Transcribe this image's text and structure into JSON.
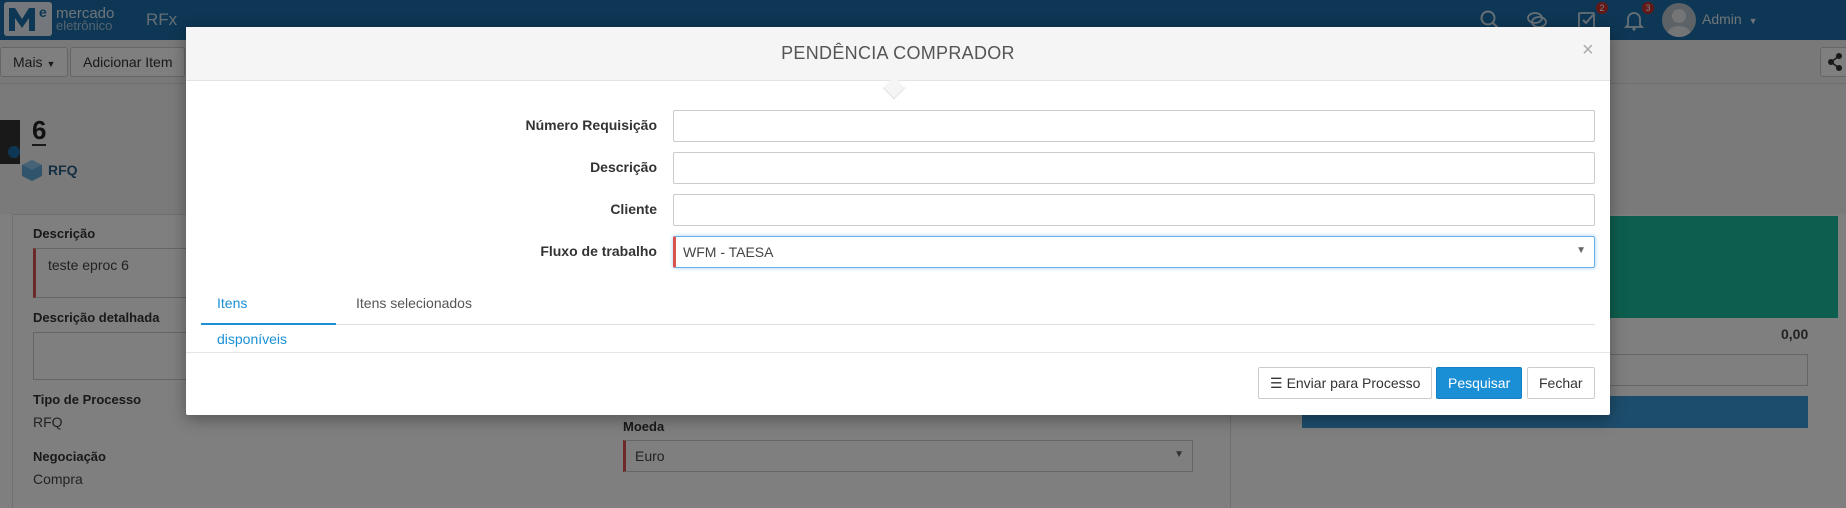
{
  "app": {
    "logo_line1": "mercado",
    "logo_line2": "eletrônico",
    "name": "RFx"
  },
  "topbar": {
    "tasks_badge": "2",
    "notifications_badge": "3",
    "user_name": "Admin"
  },
  "toolbar": {
    "more_label": "Mais",
    "add_item_label": "Adicionar Item"
  },
  "background": {
    "rfq_number": "6",
    "rfq_label": "RFQ",
    "descricao_label": "Descrição",
    "descricao_value": "teste eproc 6",
    "descricao_detalhada_label": "Descrição detalhada",
    "tipo_processo_label": "Tipo de Processo",
    "tipo_processo_value": "RFQ",
    "negociacao_label": "Negociação",
    "negociacao_value": "Compra",
    "moeda_label": "Moeda",
    "moeda_value": "Euro",
    "total_value": "0,00"
  },
  "modal": {
    "title": "PENDÊNCIA COMPRADOR",
    "close_symbol": "×",
    "fields": {
      "numero_requisicao_label": "Número Requisição",
      "numero_requisicao_value": "",
      "descricao_label": "Descrição",
      "descricao_value": "",
      "cliente_label": "Cliente",
      "cliente_value": "",
      "fluxo_label": "Fluxo de trabalho",
      "fluxo_value": "WFM - TAESA"
    },
    "tabs": [
      {
        "label": "Itens disponíveis",
        "active": true
      },
      {
        "label": "Itens selecionados",
        "active": false
      }
    ],
    "buttons": {
      "send_label": "Enviar para Processo",
      "search_label": "Pesquisar",
      "close_label": "Fechar"
    }
  },
  "colors": {
    "topbar": "#1b6fa8",
    "primary": "#1a8fd6",
    "required": "#d9534f",
    "teal": "#1abc9c"
  }
}
